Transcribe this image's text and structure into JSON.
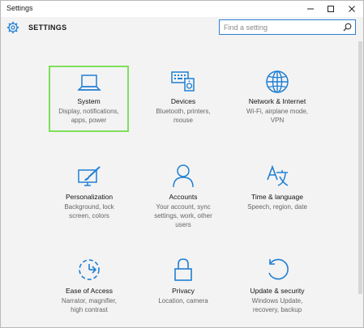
{
  "window": {
    "title": "Settings"
  },
  "header": {
    "title": "SETTINGS"
  },
  "search": {
    "placeholder": "Find a setting"
  },
  "tiles": [
    {
      "title": "System",
      "desc": "Display, notifications, apps, power",
      "icon": "laptop-icon"
    },
    {
      "title": "Devices",
      "desc": "Bluetooth, printers, mouse",
      "icon": "devices-icon"
    },
    {
      "title": "Network & Internet",
      "desc": "Wi-Fi, airplane mode, VPN",
      "icon": "globe-icon"
    },
    {
      "title": "Personalization",
      "desc": "Background, lock screen, colors",
      "icon": "paint-icon"
    },
    {
      "title": "Accounts",
      "desc": "Your account, sync settings, work, other users",
      "icon": "person-icon"
    },
    {
      "title": "Time & language",
      "desc": "Speech, region, date",
      "icon": "time-language-icon"
    },
    {
      "title": "Ease of Access",
      "desc": "Narrator, magnifier, high contrast",
      "icon": "ease-of-access-icon"
    },
    {
      "title": "Privacy",
      "desc": "Location, camera",
      "icon": "lock-icon"
    },
    {
      "title": "Update & security",
      "desc": "Windows Update, recovery, backup",
      "icon": "refresh-icon"
    }
  ],
  "colors": {
    "accent": "#1f7fd4",
    "selected_border": "#7ee05a"
  }
}
